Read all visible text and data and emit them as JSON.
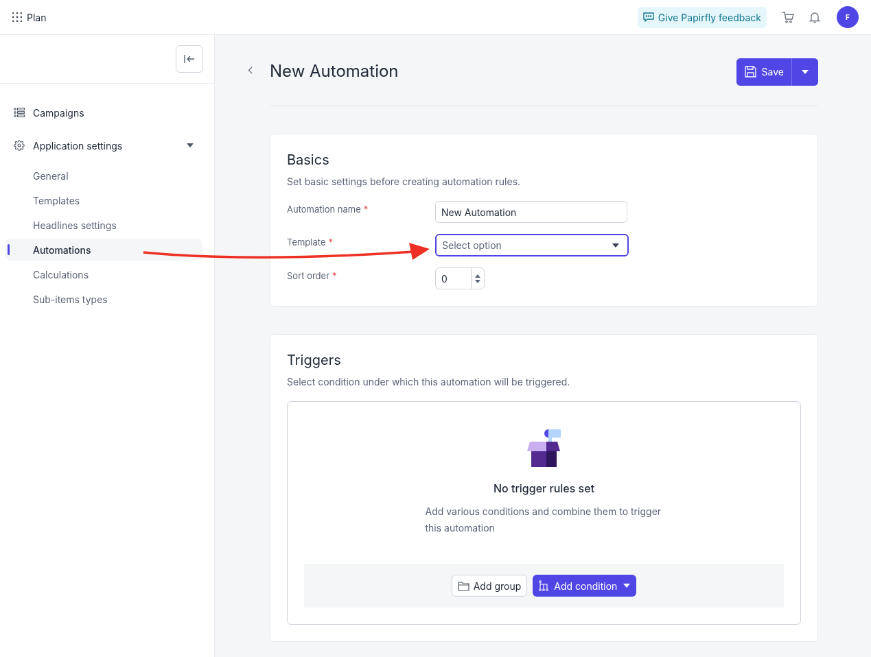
{
  "topbar": {
    "app_name": "Plan",
    "feedback_label": "Give Papirfly feedback",
    "avatar_initial": "F"
  },
  "sidebar": {
    "items": [
      {
        "label": "Campaigns"
      },
      {
        "label": "Application settings",
        "expanded": true,
        "children": [
          {
            "label": "General",
            "selected": false
          },
          {
            "label": "Templates",
            "selected": false
          },
          {
            "label": "Headlines settings",
            "selected": false
          },
          {
            "label": "Automations",
            "selected": true
          },
          {
            "label": "Calculations",
            "selected": false
          },
          {
            "label": "Sub-items types",
            "selected": false
          }
        ]
      }
    ]
  },
  "page": {
    "title": "New Automation",
    "save_label": "Save"
  },
  "basics": {
    "title": "Basics",
    "description": "Set basic settings before creating automation rules.",
    "fields": [
      {
        "kind": "text",
        "label": "Automation name",
        "required_mark": "*",
        "value": "New Automation",
        "focused": false
      },
      {
        "kind": "select",
        "label": "Template",
        "required_mark": "*",
        "placeholder": "Select option",
        "focused": true
      },
      {
        "kind": "number",
        "label": "Sort order",
        "required_mark": "*",
        "value": "0",
        "focused": false
      }
    ]
  },
  "triggers": {
    "title": "Triggers",
    "description": "Select condition under which this automation will be triggered.",
    "empty_title": "No trigger rules set",
    "empty_text": "Add various conditions and combine them to trigger this automation",
    "add_group_label": "Add group",
    "add_condition_label": "Add condition"
  }
}
